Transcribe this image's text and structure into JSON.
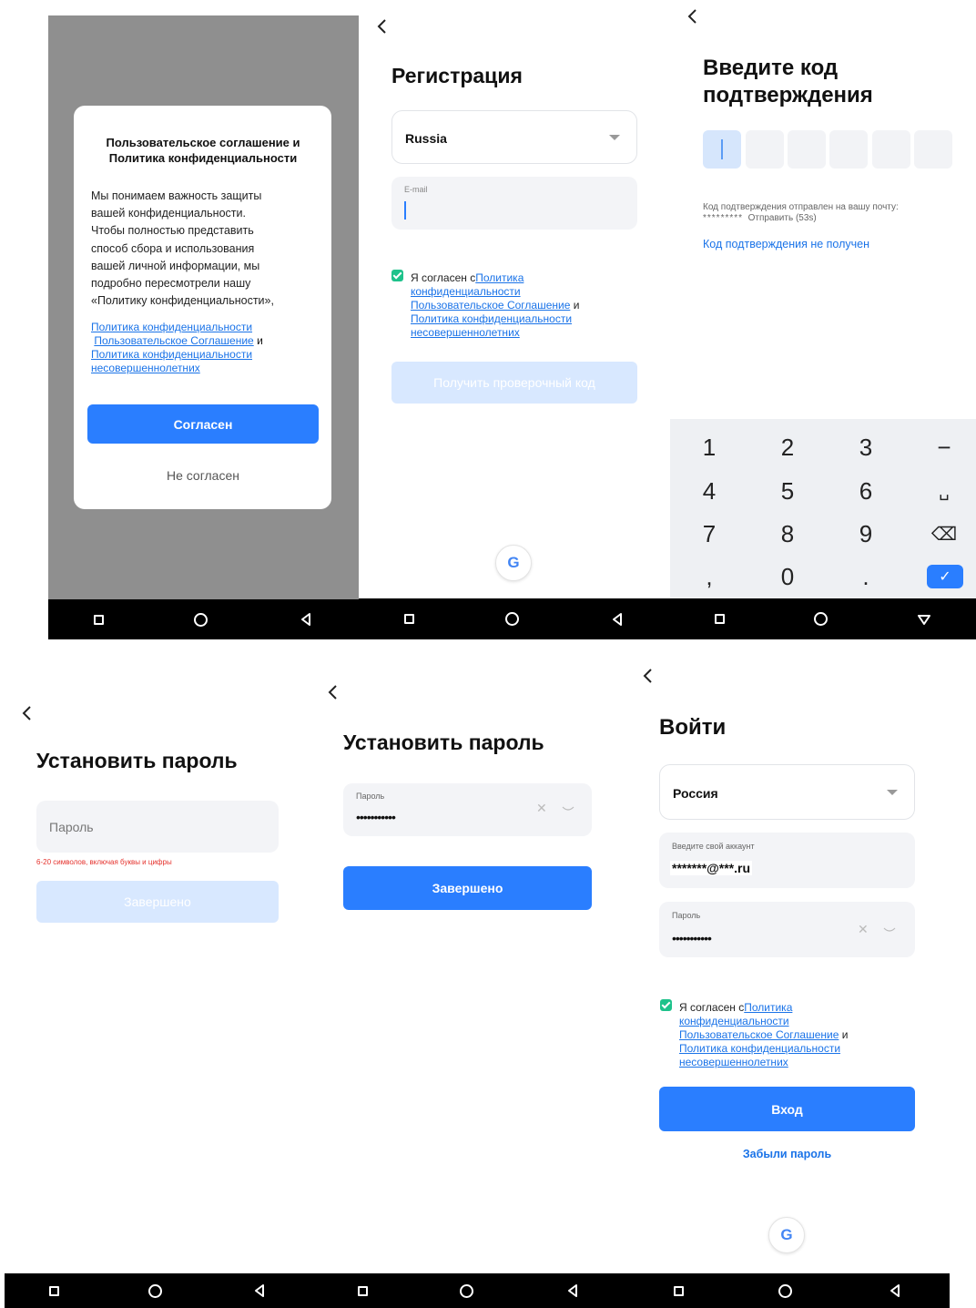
{
  "screen1": {
    "dialog_title": "Пользовательское соглашение и Политика конфиденциальности",
    "body_lines": [
      "Мы понимаем важность защиты",
      "вашей конфиденциальности.",
      "Чтобы полностью представить",
      "способ сбора и использования",
      "вашей личной информации, мы",
      "подробно пересмотрели нашу",
      "«Политику конфиденциальности»,"
    ],
    "link_privacy": "Политика конфиденциальности",
    "link_user_agreement": "Пользовательское Соглашение",
    "and": "и",
    "link_minors_1": "Политика конфиденциальности",
    "link_minors_2": "несовершеннолетних",
    "agree_button": "Согласен",
    "disagree_button": "Не согласен"
  },
  "screen2": {
    "title": "Регистрация",
    "country": "Russia",
    "email_label": "E-mail",
    "consent_prefix": "Я согласен с",
    "consent_link1": "Политика",
    "consent_link1b": "конфиденциальности",
    "consent_link2": "Пользовательское Соглашение",
    "consent_and": "и",
    "consent_link3": "Политика конфиденциальности",
    "consent_link3b": "несовершеннолетних",
    "get_code_button": "Получить проверочный код",
    "google_icon_glyph": "G"
  },
  "screen3": {
    "title_line1": "Введите код",
    "title_line2": "подтверждения",
    "sent_text": "Код подтверждения отправлен на вашу почту:",
    "masked_email": "*********",
    "resend_text": "Отправить (53s)",
    "not_received_link": "Код подтверждения не получен",
    "keys": [
      "1",
      "2",
      "3",
      "−",
      "4",
      "5",
      "6",
      "␣",
      "7",
      "8",
      "9",
      "⌫",
      ",",
      "0",
      ".",
      "✓"
    ]
  },
  "screen4": {
    "title": "Установить пароль",
    "password_placeholder": "Пароль",
    "hint": "6-20 символов, включая буквы и цифры",
    "done_button": "Завершено"
  },
  "screen5": {
    "title": "Установить пароль",
    "password_label": "Пароль",
    "password_value": "•••••••••••",
    "done_button": "Завершено"
  },
  "screen6": {
    "title": "Войти",
    "country": "Россия",
    "account_label": "Введите свой аккаунт",
    "account_value": "*******@***.ru",
    "password_label": "Пароль",
    "password_value": "•••••••••••",
    "consent_prefix": "Я согласен с",
    "consent_link1": "Политика",
    "consent_link1b": "конфиденциальности",
    "consent_link2": "Пользовательское Соглашение",
    "consent_and": "и",
    "consent_link3": "Политика конфиденциальности",
    "consent_link3b": "несовершеннолетних",
    "login_button": "Вход",
    "forgot_link": "Забыли пароль",
    "google_icon_glyph": "G"
  },
  "colors": {
    "primary": "#2a7eff",
    "primary_disabled": "#d8e8ff",
    "link": "#1a73e8",
    "check": "#1ec28b",
    "error": "#e5322d",
    "overlay": "#8f8f8f"
  }
}
